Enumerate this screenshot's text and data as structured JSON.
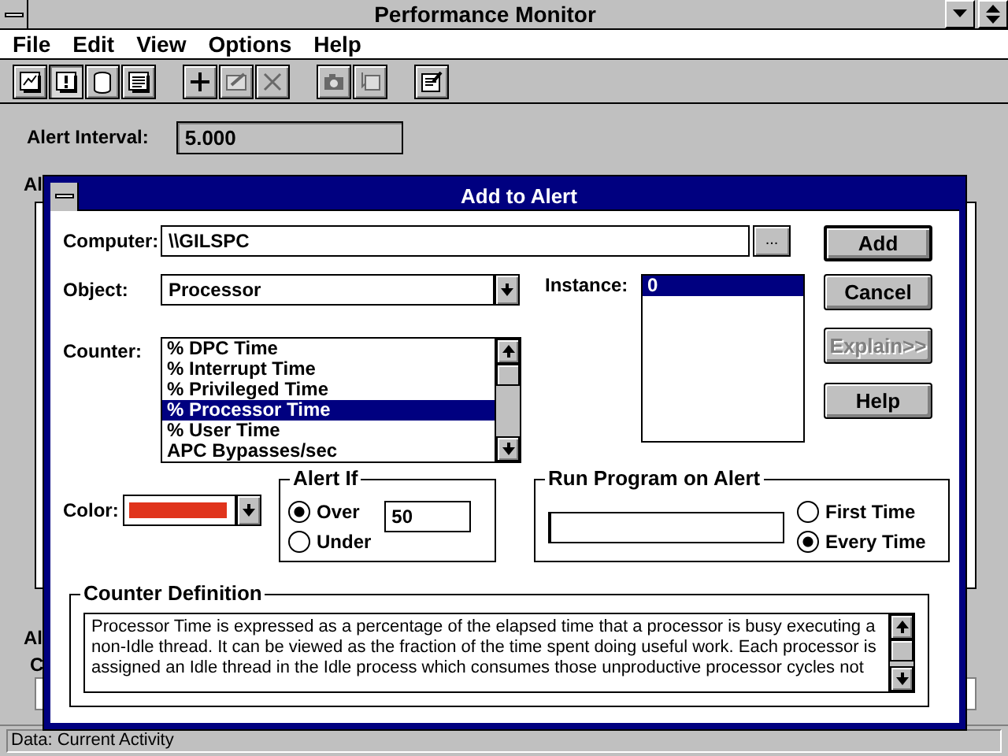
{
  "window": {
    "title": "Performance Monitor"
  },
  "menu": [
    {
      "label": "File"
    },
    {
      "label": "Edit"
    },
    {
      "label": "View"
    },
    {
      "label": "Options"
    },
    {
      "label": "Help"
    }
  ],
  "toolbar": [
    [
      {
        "kind": "chart",
        "pressed": false,
        "disabled": false
      },
      {
        "kind": "alert",
        "pressed": true,
        "disabled": false
      },
      {
        "kind": "log",
        "pressed": false,
        "disabled": false
      },
      {
        "kind": "report",
        "pressed": false,
        "disabled": false
      }
    ],
    [
      {
        "kind": "add",
        "pressed": false,
        "disabled": false
      },
      {
        "kind": "edit",
        "pressed": false,
        "disabled": true
      },
      {
        "kind": "delete",
        "pressed": false,
        "disabled": true
      }
    ],
    [
      {
        "kind": "snapshot",
        "pressed": false,
        "disabled": true
      },
      {
        "kind": "bookmark",
        "pressed": false,
        "disabled": true
      }
    ],
    [
      {
        "kind": "options",
        "pressed": false,
        "disabled": false
      }
    ]
  ],
  "alert_interval": {
    "label": "Alert Interval:",
    "value": "5.000"
  },
  "hidden_labels": [
    "Al",
    "Al",
    "C"
  ],
  "dialog": {
    "title": "Add to Alert",
    "computer": {
      "label": "Computer:",
      "value": "\\\\GILSPC",
      "browse": "..."
    },
    "object": {
      "label": "Object:",
      "value": "Processor"
    },
    "instance": {
      "label": "Instance:",
      "items": [
        {
          "label": "0",
          "selected": true
        }
      ]
    },
    "counter": {
      "label": "Counter:",
      "items": [
        {
          "label": "% DPC Time",
          "selected": false
        },
        {
          "label": "% Interrupt Time",
          "selected": false
        },
        {
          "label": "% Privileged Time",
          "selected": false
        },
        {
          "label": "% Processor Time",
          "selected": true
        },
        {
          "label": "% User Time",
          "selected": false
        },
        {
          "label": "APC Bypasses/sec",
          "selected": false
        }
      ]
    },
    "buttons": [
      {
        "label": "Add",
        "default": true,
        "disabled": false
      },
      {
        "label": "Cancel",
        "default": false,
        "disabled": false
      },
      {
        "label": "Explain>>",
        "default": false,
        "disabled": true
      },
      {
        "label": "Help",
        "default": false,
        "disabled": false
      }
    ],
    "color": {
      "label": "Color:",
      "color": "#e0341c"
    },
    "alert_if": {
      "title": "Alert If",
      "value": "50",
      "options": [
        {
          "label": "Over",
          "selected": true
        },
        {
          "label": "Under",
          "selected": false
        }
      ]
    },
    "run_program": {
      "title": "Run Program on Alert",
      "options": [
        {
          "label": "First Time",
          "selected": false
        },
        {
          "label": "Every Time",
          "selected": true
        }
      ]
    },
    "definition": {
      "title": "Counter Definition",
      "text": "Processor Time is expressed as a percentage of the elapsed time that a processor is busy executing a non-Idle thread.  It can be viewed as the fraction of the time spent doing useful work.  Each processor is assigned an Idle thread in the Idle process which consumes those unproductive processor cycles not"
    }
  },
  "status_bar": "Data: Current Activity"
}
